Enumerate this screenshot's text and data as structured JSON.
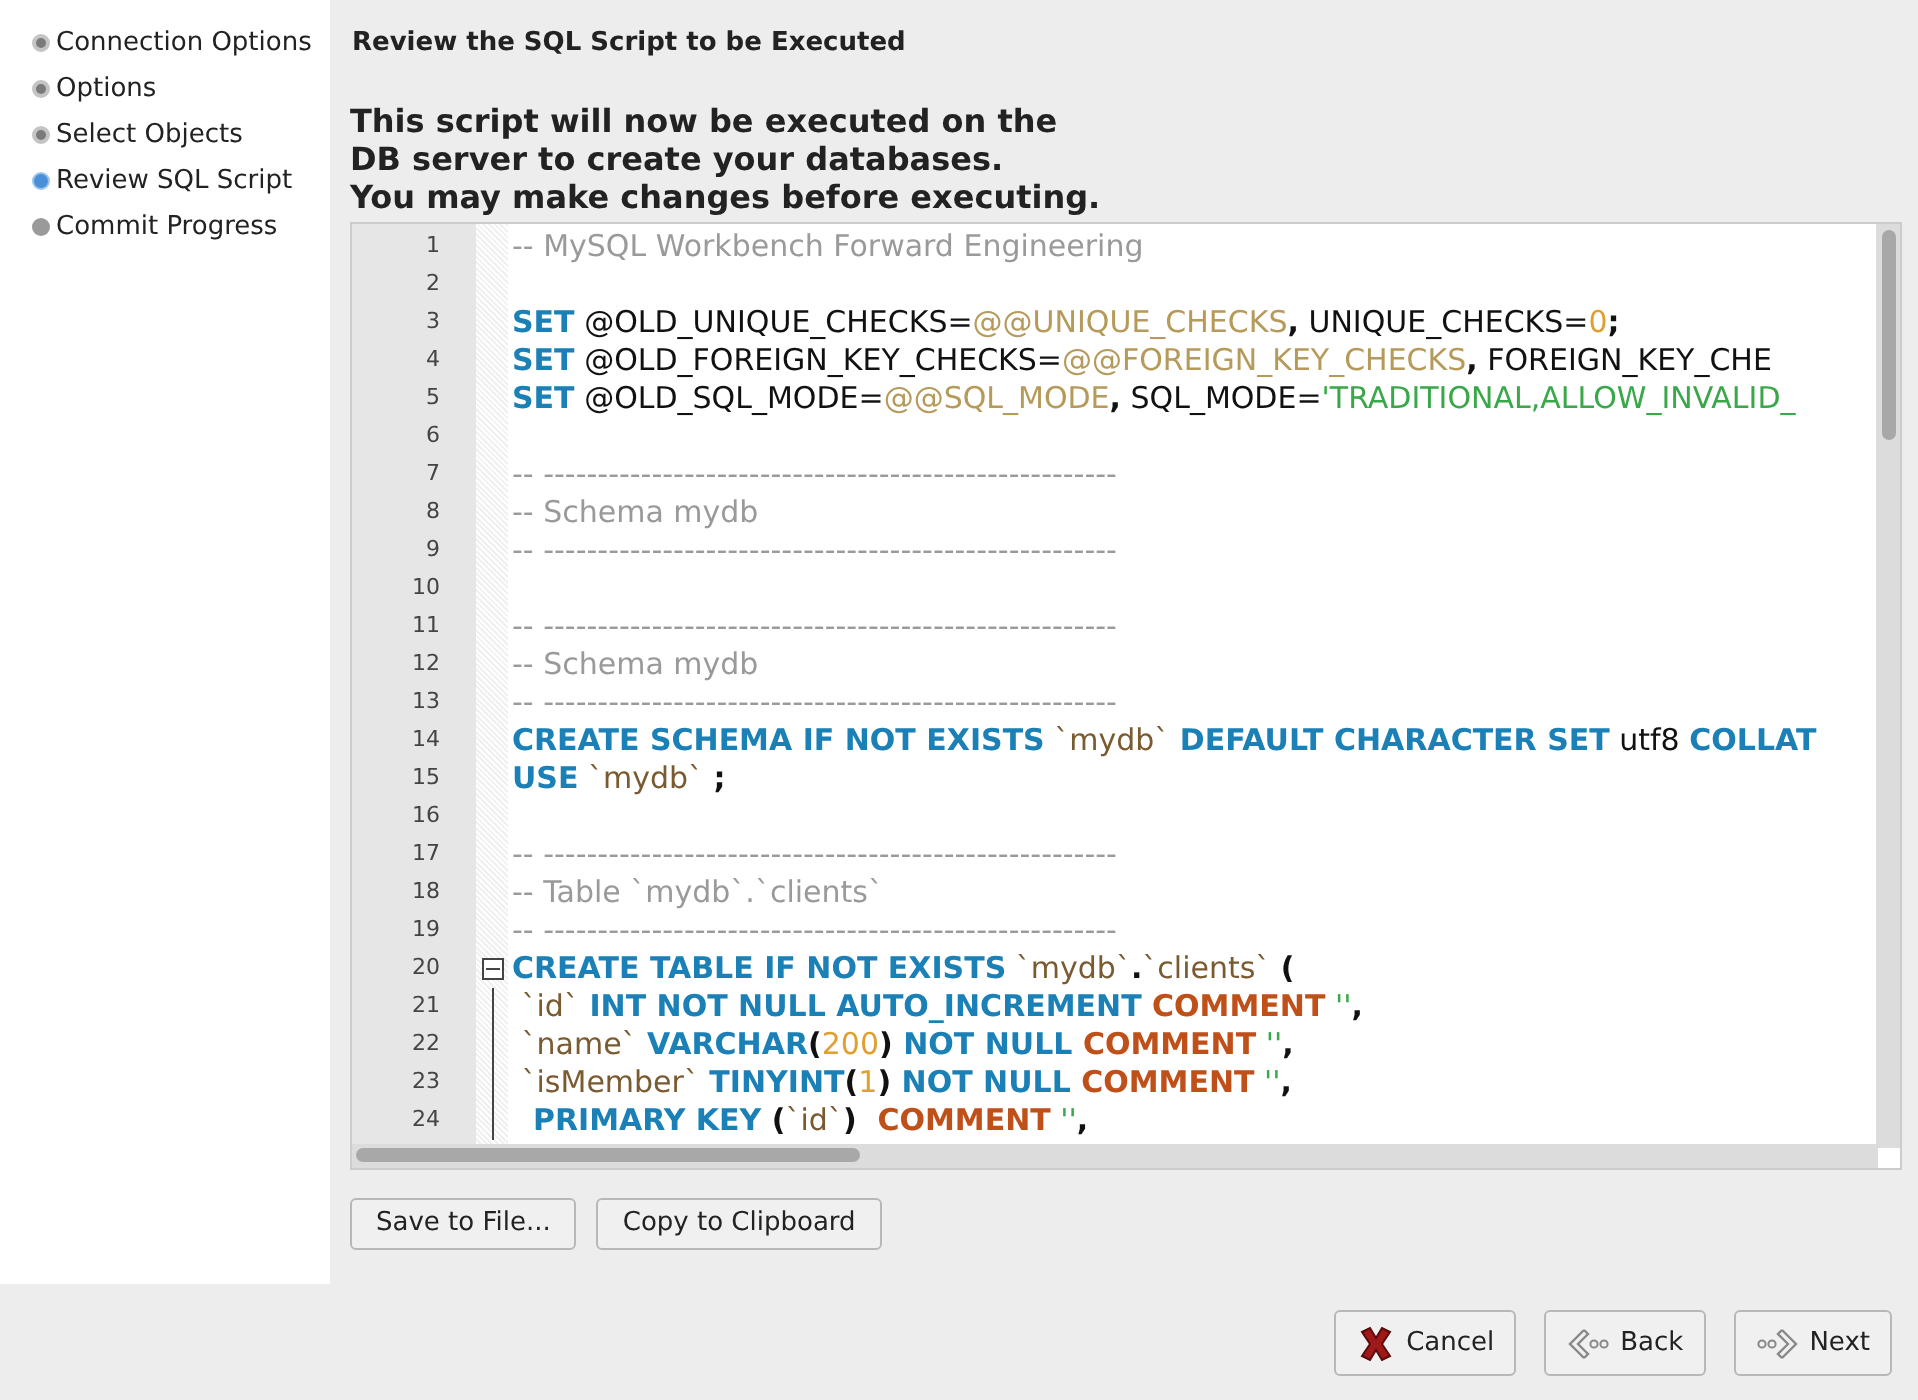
{
  "sidebar": {
    "items": [
      {
        "label": "Connection Options",
        "selected": false,
        "completed": true
      },
      {
        "label": "Options",
        "selected": false,
        "completed": true
      },
      {
        "label": "Select Objects",
        "selected": false,
        "completed": true
      },
      {
        "label": "Review SQL Script",
        "selected": true,
        "completed": false
      },
      {
        "label": "Commit Progress",
        "selected": false,
        "completed": false
      }
    ]
  },
  "page": {
    "title": "Review the SQL Script to be Executed",
    "intro": [
      "This script will now be executed on the",
      "DB server to create your databases.",
      "You may make changes before executing."
    ]
  },
  "editor": {
    "lines": [
      {
        "number": "1",
        "tokens": [
          {
            "kind": "comment",
            "text": "-- MySQL Workbench Forward Engineering"
          }
        ]
      },
      {
        "number": "2"
      },
      {
        "number": "3",
        "tokens": [
          {
            "kind": "keyword",
            "text": "SET"
          },
          {
            "kind": "plain",
            "text": " @OLD_UNIQUE_CHECKS="
          },
          {
            "kind": "variable",
            "text": "@@UNIQUE_CHECKS"
          },
          {
            "kind": "punct",
            "text": ","
          },
          {
            "kind": "plain",
            "text": " UNIQUE_CHECKS="
          },
          {
            "kind": "number",
            "text": "0"
          },
          {
            "kind": "punct",
            "text": ";"
          }
        ]
      },
      {
        "number": "4",
        "tokens": [
          {
            "kind": "keyword",
            "text": "SET"
          },
          {
            "kind": "plain",
            "text": " @OLD_FOREIGN_KEY_CHECKS="
          },
          {
            "kind": "variable",
            "text": "@@FOREIGN_KEY_CHECKS"
          },
          {
            "kind": "punct",
            "text": ","
          },
          {
            "kind": "plain",
            "text": " FOREIGN_KEY_CHE"
          }
        ]
      },
      {
        "number": "5",
        "tokens": [
          {
            "kind": "keyword",
            "text": "SET"
          },
          {
            "kind": "plain",
            "text": " @OLD_SQL_MODE="
          },
          {
            "kind": "variable",
            "text": "@@SQL_MODE"
          },
          {
            "kind": "punct",
            "text": ","
          },
          {
            "kind": "plain",
            "text": " SQL_MODE="
          },
          {
            "kind": "string",
            "text": "'TRADITIONAL,ALLOW_INVALID_"
          }
        ]
      },
      {
        "number": "6"
      },
      {
        "number": "7",
        "tokens": [
          {
            "kind": "comment",
            "text": "-- -----------------------------------------------------"
          }
        ]
      },
      {
        "number": "8",
        "tokens": [
          {
            "kind": "comment",
            "text": "-- Schema mydb"
          }
        ]
      },
      {
        "number": "9",
        "tokens": [
          {
            "kind": "comment",
            "text": "-- -----------------------------------------------------"
          }
        ]
      },
      {
        "number": "10"
      },
      {
        "number": "11",
        "tokens": [
          {
            "kind": "comment",
            "text": "-- -----------------------------------------------------"
          }
        ]
      },
      {
        "number": "12",
        "tokens": [
          {
            "kind": "comment",
            "text": "-- Schema mydb"
          }
        ]
      },
      {
        "number": "13",
        "tokens": [
          {
            "kind": "comment",
            "text": "-- -----------------------------------------------------"
          }
        ]
      },
      {
        "number": "14",
        "tokens": [
          {
            "kind": "keyword",
            "text": "CREATE SCHEMA IF NOT EXISTS"
          },
          {
            "kind": "identifier",
            "text": " `mydb`"
          },
          {
            "kind": "keyword",
            "text": " DEFAULT CHARACTER SET"
          },
          {
            "kind": "plain",
            "text": " utf8 "
          },
          {
            "kind": "keyword",
            "text": "COLLAT"
          }
        ]
      },
      {
        "number": "15",
        "tokens": [
          {
            "kind": "keyword",
            "text": "USE"
          },
          {
            "kind": "identifier",
            "text": " `mydb`"
          },
          {
            "kind": "punct",
            "text": " ;"
          }
        ]
      },
      {
        "number": "16"
      },
      {
        "number": "17",
        "tokens": [
          {
            "kind": "comment",
            "text": "-- -----------------------------------------------------"
          }
        ]
      },
      {
        "number": "18",
        "tokens": [
          {
            "kind": "comment",
            "text": "-- Table `mydb`.`clients`"
          }
        ]
      },
      {
        "number": "19",
        "tokens": [
          {
            "kind": "comment",
            "text": "-- -----------------------------------------------------"
          }
        ]
      },
      {
        "number": "20",
        "expanded": true,
        "tokens": [
          {
            "kind": "keyword",
            "text": "CREATE TABLE IF NOT EXISTS"
          },
          {
            "kind": "identifier",
            "text": " `mydb`"
          },
          {
            "kind": "punct",
            "text": "."
          },
          {
            "kind": "identifier",
            "text": "`clients`"
          },
          {
            "kind": "punct",
            "text": " ("
          }
        ],
        "children": [
          {
            "number": "21",
            "tokens": [
              {
                "kind": "identifier",
                "text": " `id`"
              },
              {
                "kind": "keyword",
                "text": " INT NOT NULL AUTO_INCREMENT"
              },
              {
                "kind": "comment_keyword",
                "text": " COMMENT"
              },
              {
                "kind": "string",
                "text": " ''"
              },
              {
                "kind": "punct",
                "text": ","
              }
            ]
          },
          {
            "number": "22",
            "tokens": [
              {
                "kind": "identifier",
                "text": " `name`"
              },
              {
                "kind": "keyword",
                "text": " VARCHAR"
              },
              {
                "kind": "punct",
                "text": "("
              },
              {
                "kind": "number",
                "text": "200"
              },
              {
                "kind": "punct",
                "text": ")"
              },
              {
                "kind": "keyword",
                "text": " NOT NULL"
              },
              {
                "kind": "comment_keyword",
                "text": " COMMENT"
              },
              {
                "kind": "string",
                "text": " ''"
              },
              {
                "kind": "punct",
                "text": ","
              }
            ]
          },
          {
            "number": "23",
            "tokens": [
              {
                "kind": "identifier",
                "text": " `isMember`"
              },
              {
                "kind": "keyword",
                "text": " TINYINT"
              },
              {
                "kind": "punct",
                "text": "("
              },
              {
                "kind": "number",
                "text": "1"
              },
              {
                "kind": "punct",
                "text": ")"
              },
              {
                "kind": "keyword",
                "text": " NOT NULL"
              },
              {
                "kind": "comment_keyword",
                "text": " COMMENT"
              },
              {
                "kind": "string",
                "text": " ''"
              },
              {
                "kind": "punct",
                "text": ","
              }
            ]
          },
          {
            "number": "24",
            "tokens": [
              {
                "kind": "keyword",
                "text": "  PRIMARY KEY"
              },
              {
                "kind": "punct",
                "text": " ("
              },
              {
                "kind": "identifier",
                "text": "`id`"
              },
              {
                "kind": "punct",
                "text": ")"
              },
              {
                "kind": "comment_keyword",
                "text": "  COMMENT"
              },
              {
                "kind": "string",
                "text": " ''"
              },
              {
                "kind": "punct",
                "text": ","
              }
            ]
          }
        ]
      }
    ]
  },
  "actions": [
    "Save to File...",
    "Copy to Clipboard"
  ],
  "wizard_buttons": [
    {
      "kind": "cancel",
      "label": "Cancel"
    },
    {
      "kind": "back",
      "label": "Back"
    },
    {
      "kind": "next",
      "label": "Next"
    }
  ]
}
